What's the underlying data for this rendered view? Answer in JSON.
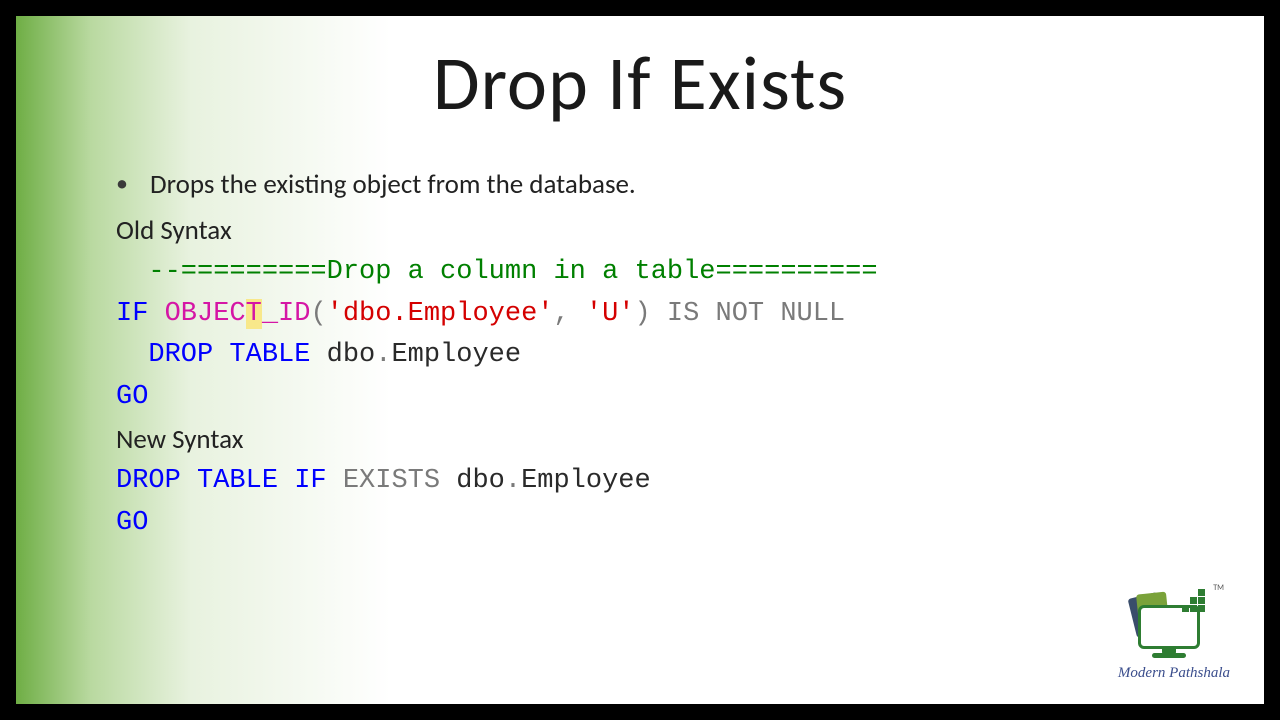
{
  "title": "Drop If Exists",
  "bullet": "Drops the existing object from the database.",
  "old_label": "Old Syntax",
  "new_label": "New Syntax",
  "code": {
    "comment_prefix": "--=========",
    "comment_text": "Drop a column in a table",
    "comment_suffix": "==========",
    "if": "IF",
    "object_part1": "OBJEC",
    "object_cursor": "T",
    "object_part2": "_ID",
    "paren_open": "(",
    "str1": "'dbo.Employee'",
    "comma": ", ",
    "str2": "'U'",
    "paren_close": ")",
    "isnotnull": " IS NOT NULL",
    "drop_table": "DROP TABLE",
    "dbo_emp_dot": " dbo",
    "dot": ".",
    "emp": "Employee",
    "go": "GO",
    "new_drop": "DROP TABLE IF",
    "exists": " EXISTS",
    "new_target": " dbo",
    "new_emp": "Employee"
  },
  "logo": {
    "tm": "TM",
    "brand": "Modern Pathshala"
  }
}
